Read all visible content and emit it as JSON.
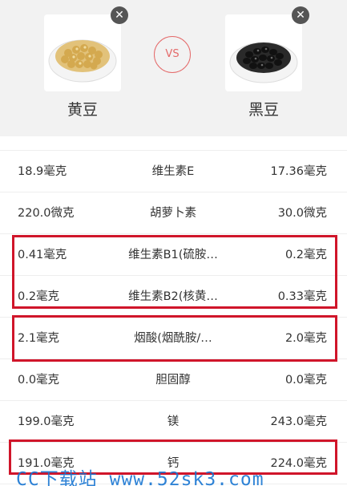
{
  "compare": {
    "vs_label": "VS",
    "left_food": {
      "name": "黄豆",
      "remove_symbol": "✕"
    },
    "right_food": {
      "name": "黑豆",
      "remove_symbol": "✕"
    }
  },
  "rows": [
    {
      "left": "18.9毫克",
      "nutrient": "维生素E",
      "right": "17.36毫克"
    },
    {
      "left": "220.0微克",
      "nutrient": "胡萝卜素",
      "right": "30.0微克"
    },
    {
      "left": "0.41毫克",
      "nutrient": "维生素B1(硫胺…",
      "right": "0.2毫克"
    },
    {
      "left": "0.2毫克",
      "nutrient": "维生素B2(核黄…",
      "right": "0.33毫克"
    },
    {
      "left": "2.1毫克",
      "nutrient": "烟酸(烟酰胺/…",
      "right": "2.0毫克"
    },
    {
      "left": "0.0毫克",
      "nutrient": "胆固醇",
      "right": "0.0毫克"
    },
    {
      "left": "199.0毫克",
      "nutrient": "镁",
      "right": "243.0毫克"
    },
    {
      "left": "191.0毫克",
      "nutrient": "钙",
      "right": "224.0毫克"
    }
  ],
  "watermark": "CC下载站 www.52sk3.com",
  "colors": {
    "highlight": "#d0152a",
    "vs": "#e46a6a",
    "watermark": "#1976d2"
  }
}
